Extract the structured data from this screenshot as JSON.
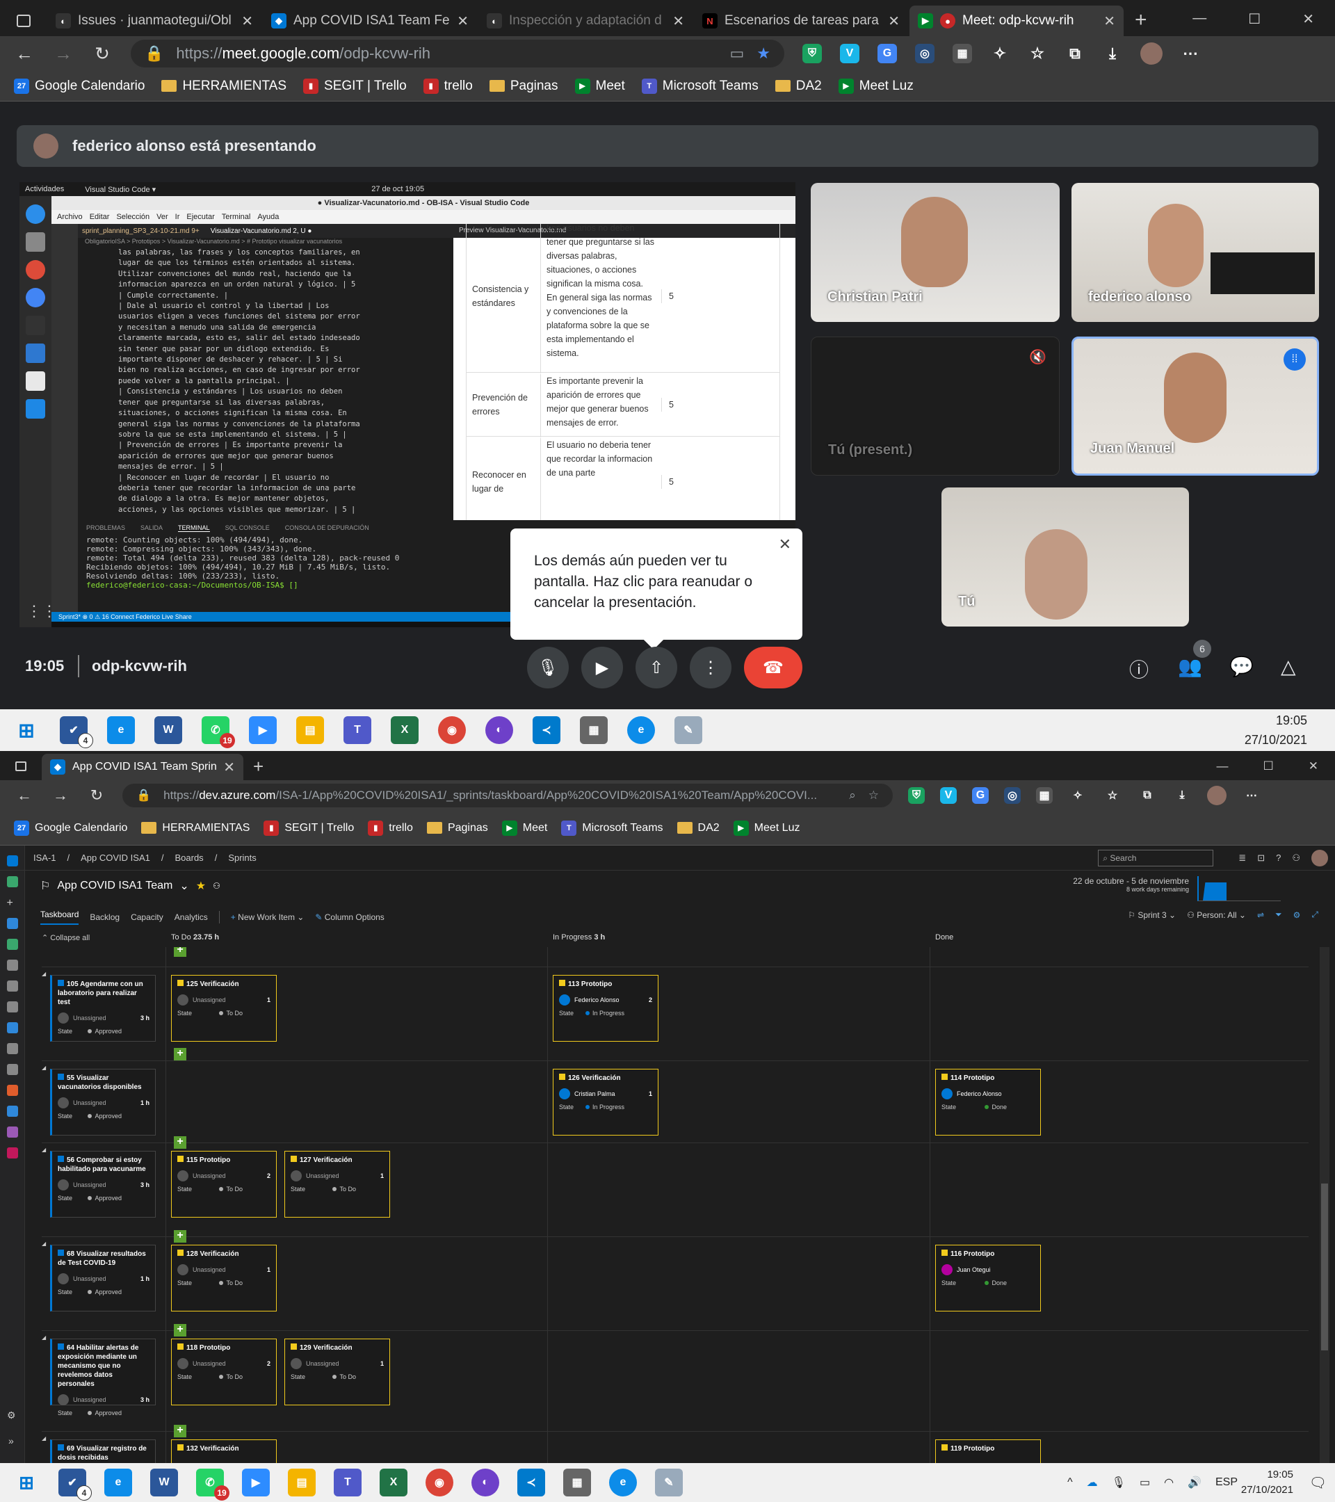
{
  "browser1": {
    "tabs": [
      {
        "label": "Issues · juanmaotegui/Obl",
        "icon": "github-icon"
      },
      {
        "label": "App COVID ISA1 Team Fe",
        "icon": "azure-icon"
      },
      {
        "label": "Inspección y adaptación d",
        "icon": "github-icon"
      },
      {
        "label": "Escenarios de tareas para",
        "icon": "n-icon"
      },
      {
        "label": "Meet: odp-kcvw-rih",
        "icon": "meet-icon"
      }
    ],
    "url_prefix": "https://",
    "url_host": "meet.google.com",
    "url_path": "/odp-kcvw-rih"
  },
  "bookmarks": [
    {
      "label": "Google Calendario",
      "kind": "cal"
    },
    {
      "label": "HERRAMIENTAS",
      "kind": "folder"
    },
    {
      "label": "SEGIT | Trello",
      "kind": "trello"
    },
    {
      "label": "trello",
      "kind": "trello"
    },
    {
      "label": "Paginas",
      "kind": "folder"
    },
    {
      "label": "Meet",
      "kind": "meet"
    },
    {
      "label": "Microsoft Teams",
      "kind": "teams"
    },
    {
      "label": "DA2",
      "kind": "folder"
    },
    {
      "label": "Meet Luz",
      "kind": "meet"
    }
  ],
  "meet": {
    "banner": "federico alonso está presentando",
    "participants": [
      {
        "name": "Christian Patri"
      },
      {
        "name": "federico alonso"
      },
      {
        "name": "Tú (present.)"
      },
      {
        "name": "Juan Manuel"
      },
      {
        "name": "Tú"
      }
    ],
    "tooltip": "Los demás aún pueden ver tu pantalla. Haz clic para reanudar o cancelar la presentación.",
    "time": "19:05",
    "code": "odp-kcvw-rih",
    "people_count": "6"
  },
  "shared": {
    "topbar_activities": "Actividades",
    "topbar_app": "Visual Studio Code ▾",
    "topbar_date": "27 de oct  19:05",
    "window_title": "● Visualizar-Vacunatorio.md - OB-ISA - Visual Studio Code",
    "menu": [
      "Archivo",
      "Editar",
      "Selección",
      "Ver",
      "Ir",
      "Ejecutar",
      "Terminal",
      "Ayuda"
    ],
    "editor_lines": [
      "las palabras, las frases y los conceptos familiares, en",
      "lugar de que los términos estén orientados al sistema.",
      "Utilizar convenciones del mundo real, haciendo que la",
      "informacion aparezca en un orden natural y lógico. | 5",
      "| Cumple correctamente. |",
      "| Dale al usuario el control y la libertad | Los",
      "usuarios eligen a veces funciones del sistema por error",
      "y necesitan a menudo una salida de emergencia",
      "claramente marcada, esto es, salir del estado indeseado",
      "sin tener que pasar por un didlogo extendido. Es",
      "importante disponer de deshacer y rehacer. | 5 | Si",
      "bien no realiza acciones, en caso de ingresar por error",
      "puede volver a la pantalla principal. |",
      "| Consistencia y estándares | Los usuarios no deben",
      "tener que preguntarse si las diversas palabras,",
      "situaciones, o acciones significan la misma cosa. En",
      "general siga las normas y convenciones de la plataforma",
      "sobre la que se esta implementando el sistema. | 5 |",
      "| Prevención de errores | Es importante prevenir la",
      "aparición de errores que mejor que generar buenos",
      "mensajes de error. | 5 |",
      "| Reconocer en lugar de recordar | El usuario no",
      "deberia tener que recordar la informacion de una parte",
      "de dialogo a la otra. Es mejor mantener objetos,",
      "acciones, y las opciones visibles que memorizar. | 5 |"
    ],
    "preview_rows": [
      {
        "heuristic": "Consistencia y estándares",
        "desc": "Los usuarios no deben tener que preguntarse si las diversas palabras, situaciones, o acciones significan la misma cosa. En general siga las normas y convenciones de la plataforma sobre la que se esta implementando el sistema.",
        "score": "5"
      },
      {
        "heuristic": "Prevención de errores",
        "desc": "Es importante prevenir la aparición de errores que mejor que generar buenos mensajes de error.",
        "score": "5"
      },
      {
        "heuristic": "Reconocer en lugar de",
        "desc": "El usuario no deberia tener que recordar la informacion de una parte",
        "score": "5"
      }
    ],
    "terminal_tabs": [
      "PROBLEMAS",
      "SALIDA",
      "TERMINAL",
      "SQL CONSOLE",
      "CONSOLA DE DEPURACIÓN"
    ],
    "terminal_lines": [
      "remote: Counting objects: 100% (494/494), done.",
      "remote: Compressing objects: 100% (343/343), done.",
      "remote: Total 494 (delta 233), reused 383 (delta 128), pack-reused 0",
      "Recibiendo objetos: 100% (494/494), 10.27 MiB | 7.45 MiB/s, listo.",
      "Resolviendo deltas: 100% (233/233), listo.",
      "federico@federico-casa:~/Documentos/OB-ISA$ []"
    ],
    "statusbar": "Sprint3*   ⊗ 0 ⚠ 16   Connect   Federico   Live Share"
  },
  "taskbar1": {
    "time": "19:05",
    "date": "27/10/2021"
  },
  "browser2": {
    "tab": "App COVID ISA1 Team Sprint 3",
    "url_prefix": "https://",
    "url_host": "dev.azure.com",
    "url_path": "/ISA-1/App%20COVID%20ISA1/_sprints/taskboard/App%20COVID%20ISA1%20Team/App%20COVI..."
  },
  "azure": {
    "breadcrumb": [
      "ISA-1",
      "App COVID ISA1",
      "Boards",
      "Sprints"
    ],
    "search": "Search",
    "team": "App COVID ISA1 Team",
    "dates": "22 de octubre - 5 de noviembre",
    "remaining": "8 work days remaining",
    "tabs": [
      "Taskboard",
      "Backlog",
      "Capacity",
      "Analytics"
    ],
    "new_item": "New Work Item",
    "column_options": "Column Options",
    "sprint": "Sprint 3",
    "person": "Person: All",
    "collapse": "Collapse all",
    "columns": [
      {
        "name": "To Do",
        "hours": "23.75 h"
      },
      {
        "name": "In Progress",
        "hours": "3 h"
      },
      {
        "name": "Done",
        "hours": ""
      }
    ],
    "stories": [
      {
        "id": "105",
        "title": "Agendarme con un laboratorio para realizar test",
        "assignee": "Unassigned",
        "hours": "3 h",
        "state": "Approved"
      },
      {
        "id": "55",
        "title": "Visualizar vacunatorios disponibles",
        "assignee": "Unassigned",
        "hours": "1 h",
        "state": "Approved"
      },
      {
        "id": "56",
        "title": "Comprobar si estoy habilitado para vacunarme",
        "assignee": "Unassigned",
        "hours": "3 h",
        "state": "Approved"
      },
      {
        "id": "68",
        "title": "Visualizar resultados de Test COVID-19",
        "assignee": "Unassigned",
        "hours": "1 h",
        "state": "Approved"
      },
      {
        "id": "64",
        "title": "Habilitar alertas de exposición mediante un mecanismo que no revelemos datos personales",
        "assignee": "Unassigned",
        "hours": "3 h",
        "state": "Approved"
      },
      {
        "id": "69",
        "title": "Visualizar registro de dosis recibidas",
        "assignee": "",
        "hours": "",
        "state": ""
      }
    ],
    "tasks": [
      {
        "row": 0,
        "col": 0,
        "slot": 0,
        "id": "125",
        "title": "Verificación",
        "assignee": "Unassigned",
        "rem": "1",
        "state": "To Do"
      },
      {
        "row": 0,
        "col": 1,
        "slot": 0,
        "id": "113",
        "title": "Prototipo",
        "assignee": "Federico Alonso",
        "rem": "2",
        "state": "In Progress"
      },
      {
        "row": 1,
        "col": 1,
        "slot": 0,
        "id": "126",
        "title": "Verificación",
        "assignee": "Cristian Palma",
        "rem": "1",
        "state": "In Progress"
      },
      {
        "row": 1,
        "col": 2,
        "slot": 0,
        "id": "114",
        "title": "Prototipo",
        "assignee": "Federico Alonso",
        "rem": "",
        "state": "Done"
      },
      {
        "row": 2,
        "col": 0,
        "slot": 0,
        "id": "115",
        "title": "Prototipo",
        "assignee": "Unassigned",
        "rem": "2",
        "state": "To Do"
      },
      {
        "row": 2,
        "col": 0,
        "slot": 1,
        "id": "127",
        "title": "Verificación",
        "assignee": "Unassigned",
        "rem": "1",
        "state": "To Do"
      },
      {
        "row": 3,
        "col": 0,
        "slot": 0,
        "id": "128",
        "title": "Verificación",
        "assignee": "Unassigned",
        "rem": "1",
        "state": "To Do"
      },
      {
        "row": 3,
        "col": 2,
        "slot": 0,
        "id": "116",
        "title": "Prototipo",
        "assignee": "Juan Otegui",
        "rem": "",
        "state": "Done"
      },
      {
        "row": 4,
        "col": 0,
        "slot": 0,
        "id": "118",
        "title": "Prototipo",
        "assignee": "Unassigned",
        "rem": "2",
        "state": "To Do"
      },
      {
        "row": 4,
        "col": 0,
        "slot": 1,
        "id": "129",
        "title": "Verificación",
        "assignee": "Unassigned",
        "rem": "1",
        "state": "To Do"
      },
      {
        "row": 5,
        "col": 0,
        "slot": 0,
        "id": "132",
        "title": "Verificación",
        "assignee": "",
        "rem": "",
        "state": ""
      },
      {
        "row": 5,
        "col": 2,
        "slot": 0,
        "id": "119",
        "title": "Prototipo",
        "assignee": "",
        "rem": "",
        "state": ""
      }
    ],
    "state_label": "State"
  },
  "taskbar2": {
    "time": "19:05",
    "date": "27/10/2021",
    "lang": "ESP"
  },
  "colors": {
    "todo": "#b2b2b2",
    "inprogress": "#0078d4",
    "done": "#339933",
    "story": "#0078d4",
    "task": "#f2cb1d",
    "end_call": "#ea4335",
    "accent_blue": "#8ab4f8"
  }
}
